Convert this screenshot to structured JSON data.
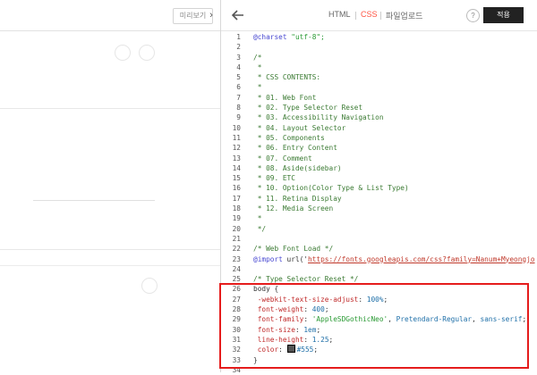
{
  "preview": {
    "button_label": "미리보기"
  },
  "collapse_glyph": "›",
  "tabs": [
    {
      "label": "HTML",
      "active": false
    },
    {
      "label": "CSS",
      "active": true
    },
    {
      "label": "파일업로드",
      "active": false
    }
  ],
  "help_label": "?",
  "apply_label": "적용",
  "code_lines": [
    {
      "n": "1",
      "parts": [
        {
          "t": "kw",
          "v": "@charset "
        },
        {
          "t": "str",
          "v": "\"utf-8\";"
        }
      ]
    },
    {
      "n": "2",
      "parts": []
    },
    {
      "n": "3",
      "parts": [
        {
          "t": "cm",
          "v": "/*"
        }
      ]
    },
    {
      "n": "4",
      "parts": [
        {
          "t": "cm",
          "v": " *"
        }
      ]
    },
    {
      "n": "5",
      "parts": [
        {
          "t": "cm",
          "v": " * CSS CONTENTS:"
        }
      ]
    },
    {
      "n": "6",
      "parts": [
        {
          "t": "cm",
          "v": " *"
        }
      ]
    },
    {
      "n": "7",
      "parts": [
        {
          "t": "cm",
          "v": " * 01. Web Font"
        }
      ]
    },
    {
      "n": "8",
      "parts": [
        {
          "t": "cm",
          "v": " * 02. Type Selector Reset"
        }
      ]
    },
    {
      "n": "9",
      "parts": [
        {
          "t": "cm",
          "v": " * 03. Accessibility Navigation"
        }
      ]
    },
    {
      "n": "10",
      "parts": [
        {
          "t": "cm",
          "v": " * 04. Layout Selector"
        }
      ]
    },
    {
      "n": "11",
      "parts": [
        {
          "t": "cm",
          "v": " * 05. Components"
        }
      ]
    },
    {
      "n": "12",
      "parts": [
        {
          "t": "cm",
          "v": " * 06. Entry Content"
        }
      ]
    },
    {
      "n": "13",
      "parts": [
        {
          "t": "cm",
          "v": " * 07. Comment"
        }
      ]
    },
    {
      "n": "14",
      "parts": [
        {
          "t": "cm",
          "v": " * 08. Aside(sidebar)"
        }
      ]
    },
    {
      "n": "15",
      "parts": [
        {
          "t": "cm",
          "v": " * 09. ETC"
        }
      ]
    },
    {
      "n": "16",
      "parts": [
        {
          "t": "cm",
          "v": " * 10. Option(Color Type & List Type)"
        }
      ]
    },
    {
      "n": "17",
      "parts": [
        {
          "t": "cm",
          "v": " * 11. Retina Display"
        }
      ]
    },
    {
      "n": "18",
      "parts": [
        {
          "t": "cm",
          "v": " * 12. Media Screen"
        }
      ]
    },
    {
      "n": "19",
      "parts": [
        {
          "t": "cm",
          "v": " *"
        }
      ]
    },
    {
      "n": "20",
      "parts": [
        {
          "t": "cm",
          "v": " */"
        }
      ]
    },
    {
      "n": "21",
      "parts": []
    },
    {
      "n": "22",
      "parts": [
        {
          "t": "cm",
          "v": "/* Web Font Load */"
        }
      ]
    },
    {
      "n": "23",
      "parts": [
        {
          "t": "kw",
          "v": "@import"
        },
        {
          "t": "tx",
          "v": " url('"
        },
        {
          "t": "url",
          "v": "https://fonts.googleapis.com/css?family=Nanum+Myeongjo"
        }
      ]
    },
    {
      "n": "24",
      "parts": []
    },
    {
      "n": "25",
      "parts": [
        {
          "t": "cm",
          "v": "/* Type Selector Reset */"
        }
      ]
    },
    {
      "n": "26",
      "parts": [
        {
          "t": "tx",
          "v": "body {"
        }
      ]
    },
    {
      "n": "27",
      "parts": [
        {
          "t": "prop",
          "v": "  -webkit-text-size-adjust"
        },
        {
          "t": "tx",
          "v": ": "
        },
        {
          "t": "val",
          "v": "100%"
        },
        {
          "t": "tx",
          "v": ";"
        }
      ]
    },
    {
      "n": "28",
      "parts": [
        {
          "t": "prop",
          "v": "  font-weight"
        },
        {
          "t": "tx",
          "v": ": "
        },
        {
          "t": "val",
          "v": "400"
        },
        {
          "t": "tx",
          "v": ";"
        }
      ]
    },
    {
      "n": "29",
      "parts": [
        {
          "t": "prop",
          "v": "  font-family"
        },
        {
          "t": "tx",
          "v": ": "
        },
        {
          "t": "str",
          "v": "'AppleSDGothicNeo'"
        },
        {
          "t": "tx",
          "v": ", "
        },
        {
          "t": "val",
          "v": "Pretendard-Regular"
        },
        {
          "t": "tx",
          "v": ", "
        },
        {
          "t": "val",
          "v": "sans-serif"
        },
        {
          "t": "tx",
          "v": ";"
        }
      ]
    },
    {
      "n": "30",
      "parts": [
        {
          "t": "prop",
          "v": "  font-size"
        },
        {
          "t": "tx",
          "v": ": "
        },
        {
          "t": "val",
          "v": "1em"
        },
        {
          "t": "tx",
          "v": ";"
        }
      ]
    },
    {
      "n": "31",
      "parts": [
        {
          "t": "prop",
          "v": "  line-height"
        },
        {
          "t": "tx",
          "v": ": "
        },
        {
          "t": "val",
          "v": "1.25"
        },
        {
          "t": "tx",
          "v": ";"
        }
      ]
    },
    {
      "n": "32",
      "parts": [
        {
          "t": "prop",
          "v": "  color"
        },
        {
          "t": "tx",
          "v": ": "
        },
        {
          "t": "swatch",
          "v": ""
        },
        {
          "t": "val",
          "v": "#555"
        },
        {
          "t": "tx",
          "v": ";"
        }
      ]
    },
    {
      "n": "33",
      "parts": [
        {
          "t": "tx",
          "v": "}"
        }
      ]
    },
    {
      "n": "34",
      "parts": []
    }
  ],
  "colors": {
    "accent": "#ff5544",
    "highlight": "#e51c1c",
    "apply_bg": "#222222",
    "swatch": "#555555"
  }
}
